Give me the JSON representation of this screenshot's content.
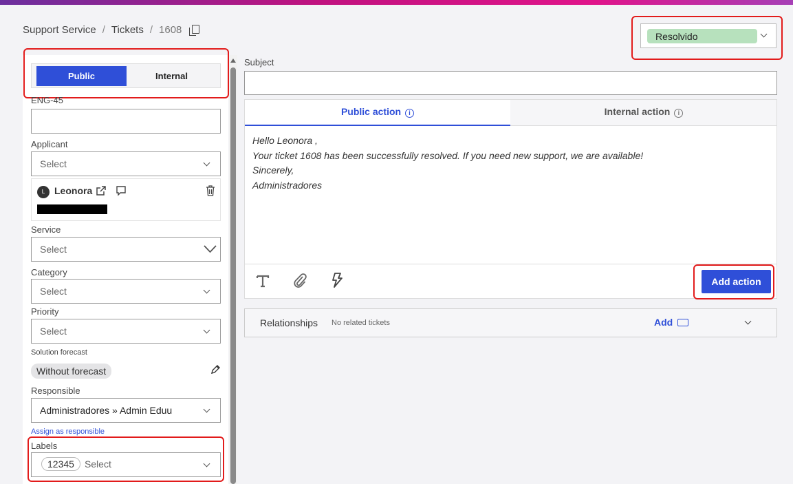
{
  "breadcrumb": {
    "root": "Support Service",
    "sep1": "/",
    "section": "Tickets",
    "sep2": "/",
    "current": "1608"
  },
  "status": {
    "value": "Resolvido"
  },
  "visibility_toggle": {
    "public": "Public",
    "internal": "Internal"
  },
  "fields": {
    "code_label": "ENG-45",
    "applicant_label": "Applicant",
    "applicant_placeholder": "Select",
    "applicant_avatar": "L",
    "applicant_name": "Leonora",
    "service_label": "Service",
    "service_placeholder": "Select",
    "category_label": "Category",
    "category_placeholder": "Select",
    "priority_label": "Priority",
    "priority_placeholder": "Select",
    "forecast_label": "Solution forecast",
    "forecast_value": "Without forecast",
    "responsible_label": "Responsible",
    "responsible_value": "Administradores » Admin Eduu",
    "assign_link": "Assign as responsible",
    "labels_label": "Labels",
    "labels_chip": "12345",
    "labels_placeholder": "Select"
  },
  "subject": {
    "label": "Subject",
    "value": ""
  },
  "editor": {
    "tab_public": "Public action",
    "tab_internal": "Internal action",
    "info_glyph": "i",
    "lines": [
      "Hello Leonora ,",
      "Your ticket 1608 has been successfully resolved. If you need new support, we are available!",
      "Sincerely,",
      "Administradores"
    ],
    "add_button": "Add action"
  },
  "relationships": {
    "title": "Relationships",
    "subtitle": "No related tickets",
    "add": "Add"
  },
  "colors": {
    "accent": "#2f4fd8",
    "status_bg": "#b7e1bd",
    "highlight": "#e21b1b"
  }
}
